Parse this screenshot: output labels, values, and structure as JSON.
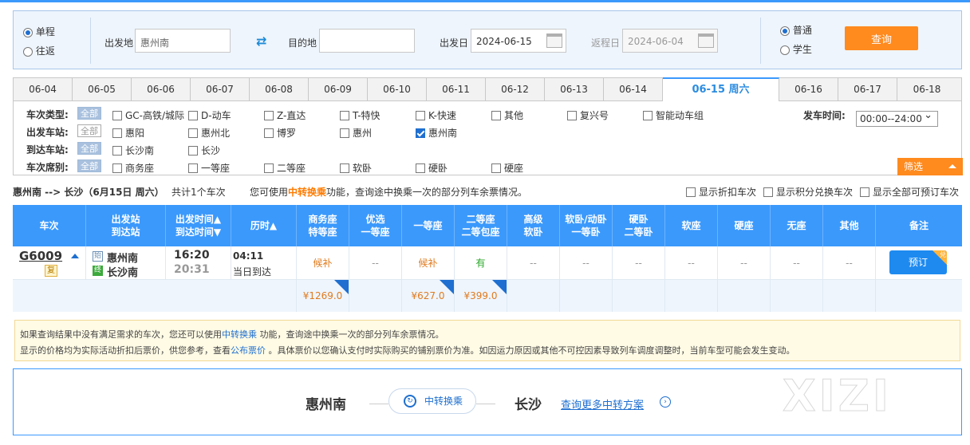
{
  "search": {
    "trip_types": [
      "单程",
      "往返"
    ],
    "from_label": "出发地",
    "from_value": "惠州南",
    "to_label": "目的地",
    "to_value": "",
    "depart_label": "出发日",
    "depart_value": "2024-06-15",
    "return_label": "返程日",
    "return_value": "2024-06-04",
    "passenger_types": [
      "普通",
      "学生"
    ],
    "query_label": "查询"
  },
  "dates": [
    "06-04",
    "06-05",
    "06-06",
    "06-07",
    "06-08",
    "06-09",
    "06-10",
    "06-11",
    "06-12",
    "06-13",
    "06-14",
    "06-15 周六",
    "06-16",
    "06-17",
    "06-18"
  ],
  "filters": {
    "all_label": "全部",
    "train_type_label": "车次类型:",
    "train_types": [
      "GC-高铁/城际",
      "D-动车",
      "Z-直达",
      "T-特快",
      "K-快速",
      "其他",
      "复兴号",
      "智能动车组"
    ],
    "depart_time_label": "发车时间:",
    "depart_time_value": "00:00--24:00",
    "from_station_label": "出发车站:",
    "from_stations": [
      "惠阳",
      "惠州北",
      "博罗",
      "惠州",
      "惠州南"
    ],
    "to_station_label": "到达车站:",
    "to_stations": [
      "长沙南",
      "长沙"
    ],
    "seat_label": "车次席别:",
    "seats": [
      "商务座",
      "一等座",
      "二等座",
      "软卧",
      "硬卧",
      "硬座"
    ],
    "filter_button": "筛选"
  },
  "summary": {
    "route": "惠州南 --> 长沙（6月15日  周六）",
    "count_text": "共计1个车次",
    "hint_pre": "您可使用",
    "hint_link": "中转换乘",
    "hint_post": "功能，查询途中换乘一次的部分列车余票情况。",
    "opt1": "显示折扣车次",
    "opt2": "显示积分兑换车次",
    "opt3": "显示全部可预订车次"
  },
  "table": {
    "headers": {
      "train": "车次",
      "station1": "出发站",
      "station2": "到达站",
      "time1": "出发时间▲",
      "time2": "到达时间▼",
      "duration": "历时▲",
      "c1a": "商务座",
      "c1b": "特等座",
      "c2a": "优选",
      "c2b": "一等座",
      "c3": "一等座",
      "c4a": "二等座",
      "c4b": "二等包座",
      "c5a": "高级",
      "c5b": "软卧",
      "c6a": "软卧/动卧",
      "c6b": "一等卧",
      "c7a": "硬卧",
      "c7b": "二等卧",
      "c8": "软座",
      "c9": "硬座",
      "c10": "无座",
      "c11": "其他",
      "c12": "备注"
    },
    "row": {
      "train_no": "G6009",
      "fu_tag": "复",
      "from_tag": "始",
      "to_tag": "终",
      "from": "惠州南",
      "to": "长沙南",
      "dep": "16:20",
      "arr": "20:31",
      "duration": "04:11",
      "arrive_day": "当日到达",
      "biz": "候补",
      "pref": "--",
      "first": "候补",
      "second": "有",
      "dash": "--",
      "book": "预订",
      "book_tag": "兑",
      "price_biz": "¥1269.0",
      "price_first": "¥627.0",
      "price_second": "¥399.0"
    }
  },
  "notice": {
    "l1_pre": "如果查询结果中没有满足需求的车次，您还可以使用",
    "l1_link": "中转换乘",
    "l1_post": " 功能，查询途中换乘一次的部分列车余票情况。",
    "l2_pre": "显示的价格均为实际活动折扣后票价，供您参考，查看",
    "l2_link": "公布票价",
    "l2_post": " 。具体票价以您确认支付时实际购买的铺别票价为准。如因运力原因或其他不可控因素导致列车调度调整时，当前车型可能会发生变动。"
  },
  "transfer": {
    "from": "惠州南",
    "button": "中转换乘",
    "to": "长沙",
    "more": "查询更多中转方案"
  },
  "watermark": "XIZI"
}
